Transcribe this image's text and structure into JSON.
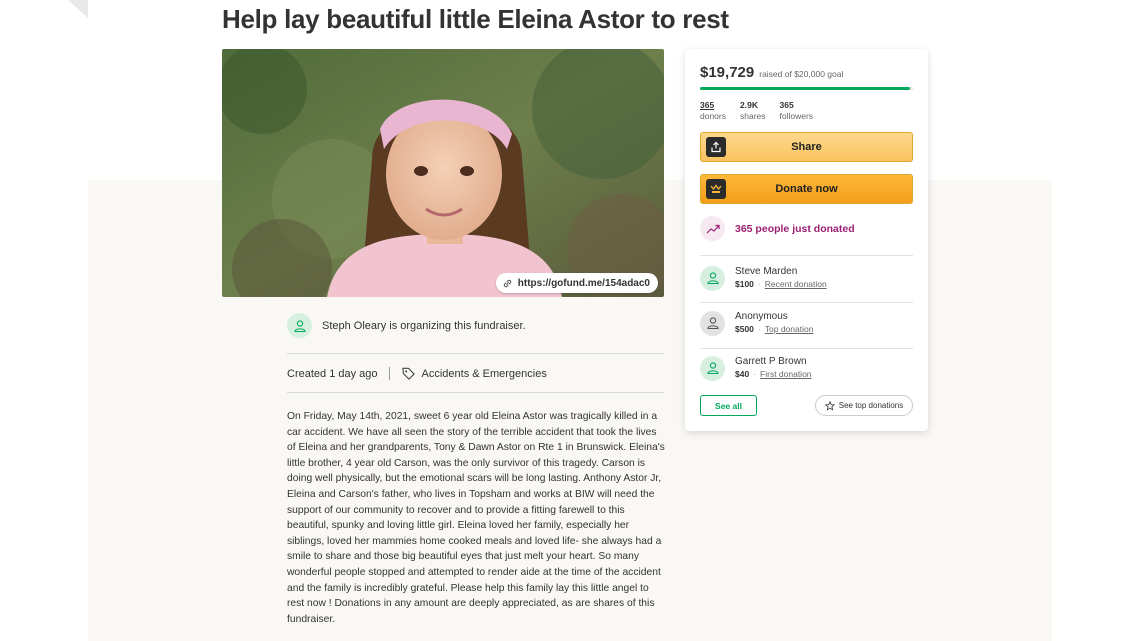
{
  "page": {
    "title": "Help lay beautiful little Eleina Astor to rest",
    "short_url": "https://gofund.me/154adac0"
  },
  "organizer": {
    "text": "Steph Oleary is organizing this fundraiser."
  },
  "meta": {
    "created": "Created 1 day ago",
    "category": "Accidents & Emergencies"
  },
  "story": "On Friday, May 14th, 2021, sweet 6 year old Eleina Astor was tragically killed in a car accident. We have all seen the story of the terrible accident that took the lives of Eleina and her grandparents, Tony & Dawn Astor on Rte 1 in Brunswick.  Eleina's little brother, 4 year old Carson, was the only survivor of this tragedy. Carson is doing well physically, but the emotional scars will be long lasting. Anthony Astor Jr,  Eleina and Carson's  father, who lives in Topsham and works at BIW will need the support of our community to recover and to provide a fitting farewell to this beautiful, spunky and loving little girl. Eleina loved her family, especially her siblings, loved her mammies home cooked meals and loved life- she always had a smile to share and those big beautiful eyes that just melt your heart. So many wonderful people stopped and attempted to render aide at the time of the accident and the family is incredibly grateful. Please help this family lay this little angel to rest now ! Donations in any amount are deeply appreciated, as are shares of this fundraiser.",
  "donation_card": {
    "raised": "$19,729",
    "goal_text": "raised of $20,000 goal",
    "progress_fraction": 0.986,
    "stats": [
      {
        "value": "365",
        "label": "donors"
      },
      {
        "value": "2.9K",
        "label": "shares"
      },
      {
        "value": "365",
        "label": "followers"
      }
    ],
    "share_label": "Share",
    "donate_label": "Donate now",
    "recent_activity": "365 people just donated",
    "donors": [
      {
        "name": "Steve Marden",
        "amount": "$100",
        "tag": "Recent donation"
      },
      {
        "name": "Anonymous",
        "amount": "$500",
        "tag": "Top donation"
      },
      {
        "name": "Garrett P Brown",
        "amount": "$40",
        "tag": "First donation"
      }
    ],
    "see_all_label": "See all",
    "see_top_label": "See top donations",
    "colors": {
      "progress": "#02a95c",
      "donate_button": "#f49c1c",
      "share_button": "#f9c35f",
      "trend_text": "#9b1f74"
    }
  },
  "icons": {
    "link": "link-icon",
    "tag": "tag-icon",
    "share": "share-upload-icon",
    "donate": "gofundme-logo-icon",
    "trend": "trending-up-icon",
    "user": "user-icon",
    "star": "star-icon"
  }
}
